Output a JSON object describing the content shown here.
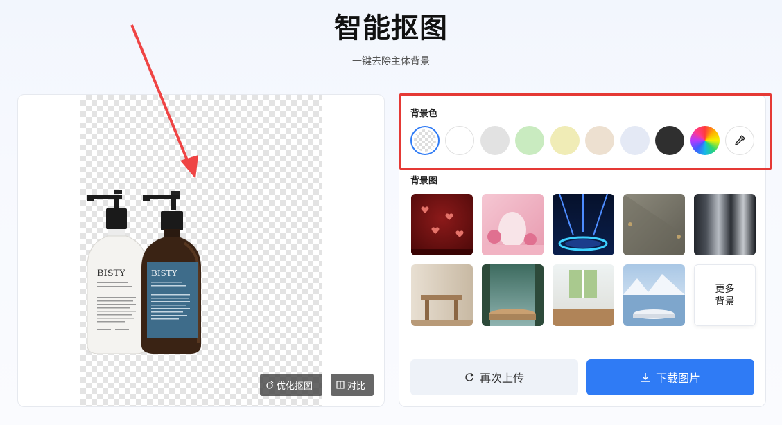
{
  "header": {
    "title": "智能抠图",
    "subtitle": "一键去除主体背景"
  },
  "preview": {
    "product_brand": "BISTY",
    "optimize_label": "优化抠图",
    "compare_label": "对比"
  },
  "background_color": {
    "label": "背景色",
    "swatches": [
      {
        "name": "transparent",
        "color": "transparent",
        "selected": true
      },
      {
        "name": "white",
        "color": "#ffffff"
      },
      {
        "name": "light-gray",
        "color": "#e2e2e2"
      },
      {
        "name": "light-green",
        "color": "#c9ebc0"
      },
      {
        "name": "light-yellow",
        "color": "#f0ecb6"
      },
      {
        "name": "beige",
        "color": "#ede0d0"
      },
      {
        "name": "light-blue",
        "color": "#e4e9f5"
      },
      {
        "name": "black",
        "color": "#2f2f2f"
      },
      {
        "name": "rainbow",
        "color": "conic"
      }
    ],
    "picker_icon": "eyedropper-icon"
  },
  "background_image": {
    "label": "背景图",
    "thumbnails": [
      "red-hearts",
      "pink-arch",
      "blue-stage",
      "gray-wall-lamp",
      "dark-stripes",
      "curtain-table",
      "forest-podium",
      "window-table",
      "mountain-lake-podium"
    ],
    "more_label_1": "更多",
    "more_label_2": "背景"
  },
  "actions": {
    "reupload_label": "再次上传",
    "download_label": "下载图片"
  },
  "colors": {
    "accent": "#2f7bf5",
    "highlight": "#e53935"
  }
}
